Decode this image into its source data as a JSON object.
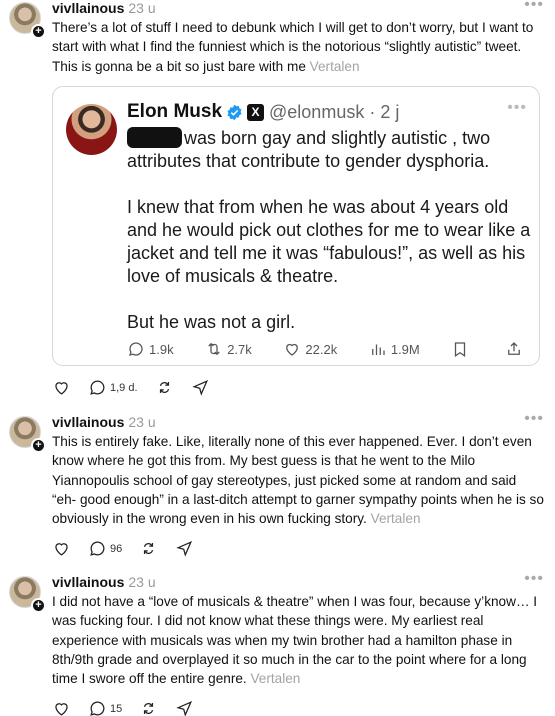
{
  "posts": [
    {
      "username": "vivllainous",
      "time": "23 u",
      "text": "There’s a lot of stuff I need to debunk which I will get to don’t worry, but I want to start with what I find the funniest which is the notorious “slightly autistic” tweet. This is gonna be a bit so just bare with me",
      "translate": "Vertalen",
      "reply_count": "1,9 d.",
      "quote": {
        "name": "Elon Musk",
        "handle": "@elonmusk",
        "time": "· 2 j",
        "paragraphs": [
          "was born gay and slightly autistic , two attributes that contribute to gender dysphoria.",
          "I knew that from when he was about 4 years old and he would pick out clothes for me to wear like a jacket and tell me it was “fabulous!”, as well as his love of musicals & theatre.",
          "But he was not a girl."
        ],
        "stats": {
          "replies": "1.9k",
          "reposts": "2.7k",
          "likes": "22.2k",
          "views": "1.9M"
        }
      }
    },
    {
      "username": "vivllainous",
      "time": "23 u",
      "text": "This is entirely fake. Like, literally none of this ever happened. Ever. I don’t even know where he got this from. My best guess is that he went to the Milo Yiannopoulis school of gay stereotypes, just picked some at random and said “eh- good enough” in a last-ditch attempt to garner sympathy points when he is so obviously in the wrong even in his own fucking story.",
      "translate": "Vertalen",
      "reply_count": "96"
    },
    {
      "username": "vivllainous",
      "time": "23 u",
      "text": "I did not have a “love of musicals & theatre” when I was four, because y’know… I was fucking four. I did not know what these things were. My earliest real experience with musicals was when my twin brother had a hamilton phase in 8th/9th grade and overplayed it so much in the car to the point where for a long time I swore off the entire genre.",
      "translate": "Vertalen",
      "reply_count": "15"
    }
  ],
  "icons": {
    "like": "heart-icon",
    "reply": "speech-bubble-icon",
    "repost": "repost-icon",
    "share": "send-icon",
    "more": "more-dots-icon"
  },
  "colors": {
    "verified": "#1d9bf0",
    "muted": "#999999",
    "border": "#d7d7d7"
  }
}
